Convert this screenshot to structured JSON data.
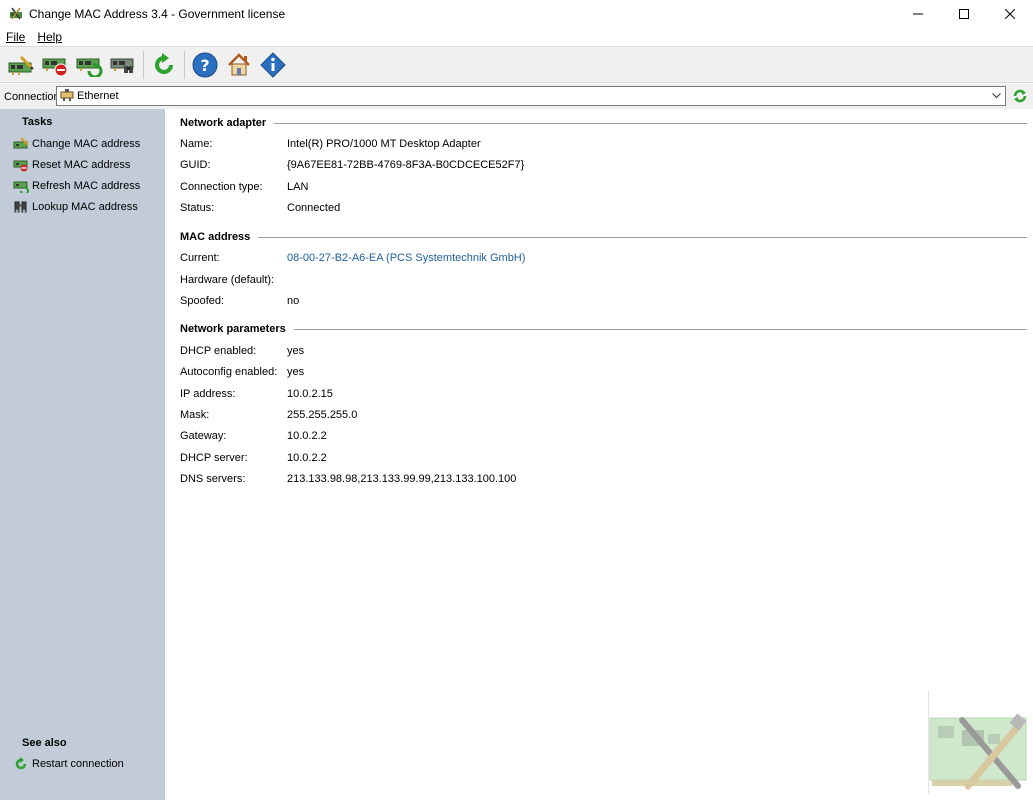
{
  "window": {
    "title": "Change MAC Address 3.4 - Government license",
    "minimize_symbol": "—",
    "maximize_symbol": "☐",
    "close_symbol": "✕"
  },
  "menu": [
    {
      "label": "File"
    },
    {
      "label": "Help"
    }
  ],
  "toolbar": {
    "buttons": [
      {
        "icon": "change-mac-icon"
      },
      {
        "icon": "reset-mac-icon"
      },
      {
        "icon": "refresh-mac-icon"
      },
      {
        "icon": "lookup-mac-icon"
      },
      {
        "icon": "restart-connection-icon"
      },
      {
        "icon": "help-icon"
      },
      {
        "icon": "home-icon"
      },
      {
        "icon": "about-icon"
      }
    ]
  },
  "connection": {
    "label": "Connection:",
    "selected": "Ethernet"
  },
  "sidebar": {
    "tasks_heading": "Tasks",
    "tasks": [
      {
        "label": "Change MAC address",
        "icon": "change-mac-icon"
      },
      {
        "label": "Reset MAC address",
        "icon": "reset-mac-icon"
      },
      {
        "label": "Refresh MAC address",
        "icon": "refresh-mac-icon"
      },
      {
        "label": "Lookup MAC address",
        "icon": "binoculars-icon"
      }
    ],
    "see_also_heading": "See also",
    "see_also": [
      {
        "label": "Restart connection",
        "icon": "restart-icon"
      }
    ]
  },
  "details": {
    "network_adapter": {
      "title": "Network adapter",
      "rows": [
        {
          "label": "Name:",
          "value": "Intel(R) PRO/1000 MT Desktop Adapter"
        },
        {
          "label": "GUID:",
          "value": "{9A67EE81-72BB-4769-8F3A-B0CDCECE52F7}"
        },
        {
          "label": "Connection type:",
          "value": "LAN"
        },
        {
          "label": "Status:",
          "value": "Connected"
        }
      ]
    },
    "mac_address": {
      "title": "MAC address",
      "rows": [
        {
          "label": "Current:",
          "value": "08-00-27-B2-A6-EA (PCS Systemtechnik GmbH)"
        },
        {
          "label": "Hardware (default):",
          "value": ""
        },
        {
          "label": "Spoofed:",
          "value": "no"
        }
      ]
    },
    "network_parameters": {
      "title": "Network parameters",
      "rows": [
        {
          "label": "DHCP enabled:",
          "value": "yes"
        },
        {
          "label": "Autoconfig enabled:",
          "value": "yes"
        },
        {
          "label": "IP address:",
          "value": "10.0.2.15"
        },
        {
          "label": "Mask:",
          "value": "255.255.255.0"
        },
        {
          "label": "Gateway:",
          "value": "10.0.2.2"
        },
        {
          "label": "DHCP server:",
          "value": "10.0.2.2"
        },
        {
          "label": "DNS servers:",
          "value": "213.133.98.98,213.133.99.99,213.133.100.100"
        }
      ]
    }
  },
  "colors": {
    "sidebar_bg": "#c2ccd8",
    "link": "#1f5f9f"
  }
}
